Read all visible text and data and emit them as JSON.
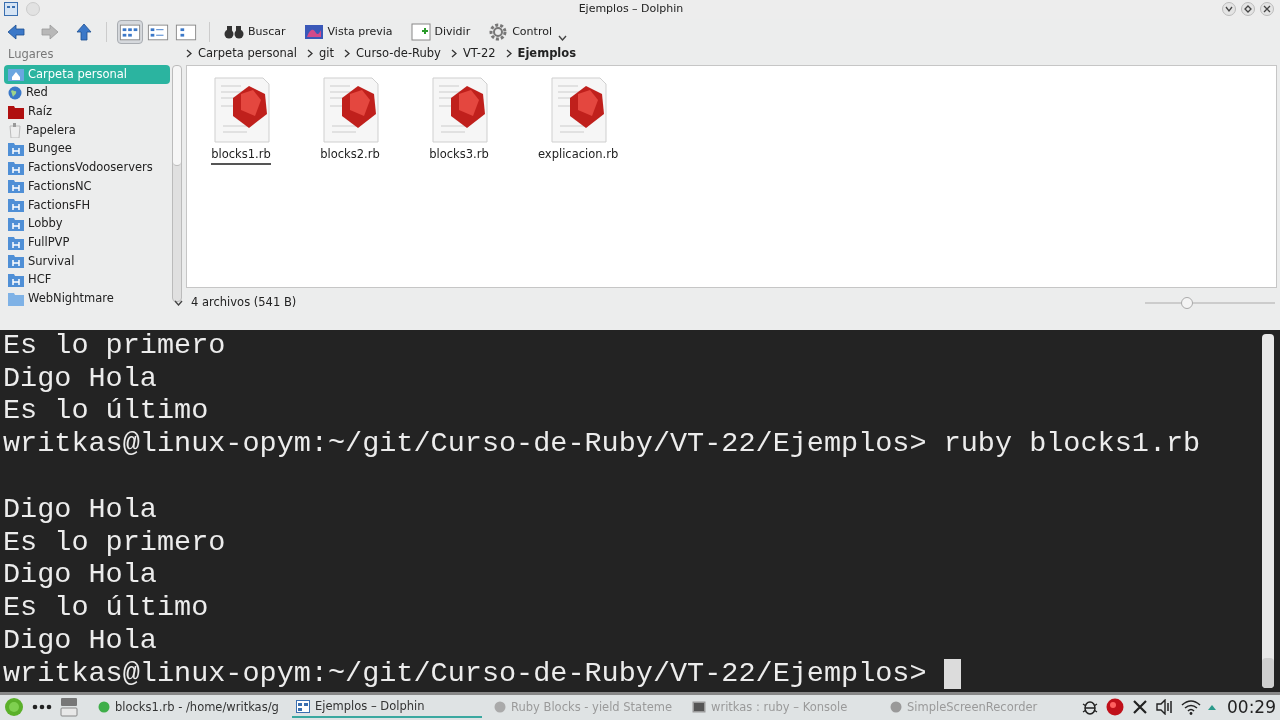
{
  "window": {
    "title": "Ejemplos – Dolphin"
  },
  "toolbar": {
    "nav": [
      {
        "kind": "back",
        "disabled": false
      },
      {
        "kind": "forward",
        "disabled": true
      },
      {
        "kind": "up",
        "disabled": false
      }
    ],
    "views": [
      {
        "kind": "icons",
        "selected": true
      },
      {
        "kind": "details",
        "selected": false
      },
      {
        "kind": "columns",
        "selected": false
      }
    ],
    "actions": [
      {
        "kind": "search",
        "label": "Buscar"
      },
      {
        "kind": "preview",
        "label": "Vista previa"
      },
      {
        "kind": "split",
        "label": "Dividir"
      },
      {
        "kind": "control",
        "label": "Control"
      }
    ]
  },
  "places": {
    "title": "Lugares",
    "items": [
      {
        "kind": "home",
        "label": "Carpeta personal",
        "selected": true
      },
      {
        "kind": "network",
        "label": "Red",
        "selected": false
      },
      {
        "kind": "root",
        "label": "Raíz",
        "selected": false
      },
      {
        "kind": "trash",
        "label": "Papelera",
        "selected": false
      },
      {
        "kind": "remote",
        "label": "Bungee",
        "selected": false
      },
      {
        "kind": "remote",
        "label": "FactionsVodooservers",
        "selected": false
      },
      {
        "kind": "remote",
        "label": "FactionsNC",
        "selected": false
      },
      {
        "kind": "remote",
        "label": "FactionsFH",
        "selected": false
      },
      {
        "kind": "remote",
        "label": "Lobby",
        "selected": false
      },
      {
        "kind": "remote",
        "label": "FullPVP",
        "selected": false
      },
      {
        "kind": "remote",
        "label": "Survival",
        "selected": false
      },
      {
        "kind": "remote",
        "label": "HCF",
        "selected": false
      },
      {
        "kind": "folder",
        "label": "WebNightmare",
        "selected": false
      }
    ]
  },
  "breadcrumb": [
    {
      "label": "Carpeta personal",
      "selected": false
    },
    {
      "label": "git",
      "selected": false
    },
    {
      "label": "Curso-de-Ruby",
      "selected": false
    },
    {
      "label": "VT-22",
      "selected": false
    },
    {
      "label": "Ejemplos",
      "selected": true
    }
  ],
  "files": [
    {
      "name": "blocks1.rb",
      "selected": true
    },
    {
      "name": "blocks2.rb",
      "selected": false
    },
    {
      "name": "blocks3.rb",
      "selected": false
    },
    {
      "name": "explicacion.rb",
      "selected": false
    }
  ],
  "status_bar": {
    "text": "4 archivos (541 B)",
    "zoom": {
      "level": 0.32
    }
  },
  "terminal": {
    "lines": [
      {
        "kind": "text",
        "text": "Es lo primero"
      },
      {
        "kind": "text",
        "text": "Digo Hola"
      },
      {
        "kind": "text",
        "text": "Es lo último"
      },
      {
        "kind": "text",
        "text": "writkas@linux-opym:~/git/Curso-de-Ruby/VT-22/Ejemplos> ruby blocks1.rb"
      },
      {
        "kind": "blank"
      },
      {
        "kind": "text",
        "text": "Digo Hola"
      },
      {
        "kind": "text",
        "text": "Es lo primero"
      },
      {
        "kind": "text",
        "text": "Digo Hola"
      },
      {
        "kind": "text",
        "text": "Es lo último"
      },
      {
        "kind": "text",
        "text": "Digo Hola"
      },
      {
        "kind": "text",
        "text": "writkas@linux-opym:~/git/Curso-de-Ruby/VT-22/Ejemplos> "
      }
    ],
    "cursor": true
  },
  "taskbar": {
    "tasks": [
      {
        "kind": "editor",
        "label": "blocks1.rb - /home/writkas/g",
        "selected": false,
        "dimmed": false
      },
      {
        "kind": "files",
        "label": "Ejemplos – Dolphin",
        "selected": true,
        "dimmed": false
      },
      {
        "kind": "browser",
        "label": "Ruby Blocks - yield Stateme",
        "selected": false,
        "dimmed": true
      },
      {
        "kind": "terminal",
        "label": "writkas : ruby – Konsole",
        "selected": false,
        "dimmed": true
      },
      {
        "kind": "recorder",
        "label": "SimpleScreenRecorder",
        "selected": false,
        "dimmed": true
      }
    ],
    "clock": "00:29"
  }
}
